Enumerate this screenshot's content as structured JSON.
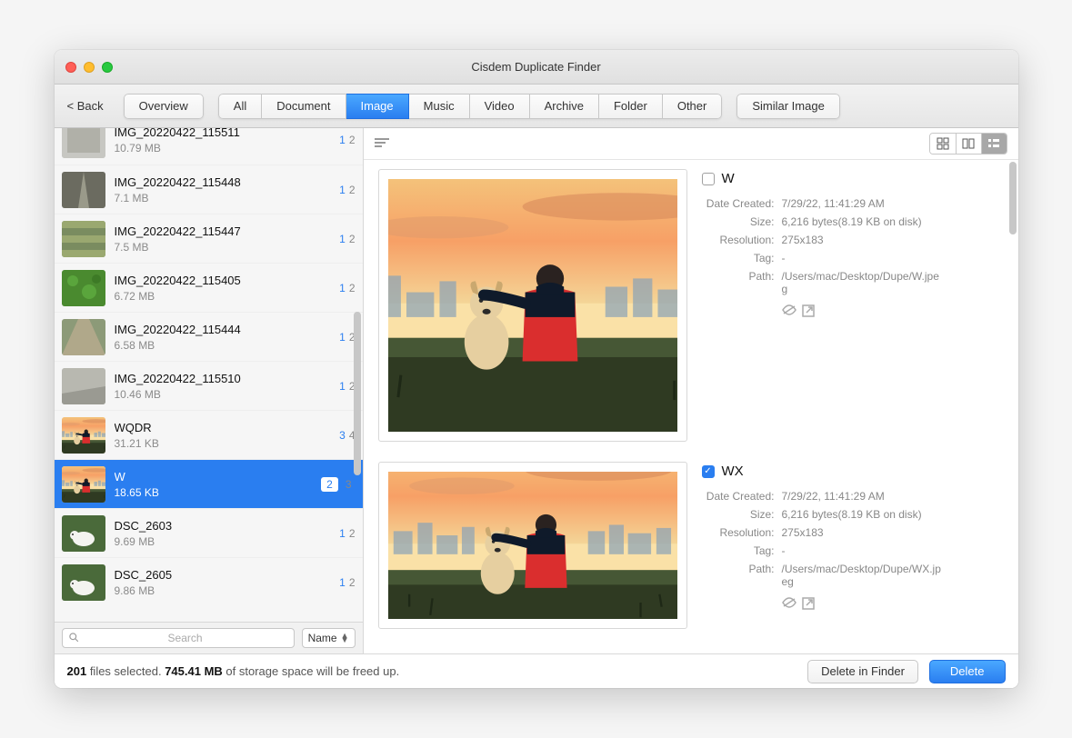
{
  "window": {
    "title": "Cisdem Duplicate Finder"
  },
  "toolbar": {
    "back": "< Back",
    "overview": "Overview",
    "tabs": [
      "All",
      "Document",
      "Image",
      "Music",
      "Video",
      "Archive",
      "Folder",
      "Other"
    ],
    "active_tab": "Image",
    "similar": "Similar Image"
  },
  "list": {
    "rows": [
      {
        "name": "IMG_20220422_115511",
        "size": "10.79 MB",
        "sel": "1",
        "tot": "2",
        "thumb": "concrete"
      },
      {
        "name": "IMG_20220422_115448",
        "size": "7.1 MB",
        "sel": "1",
        "tot": "2",
        "thumb": "road"
      },
      {
        "name": "IMG_20220422_115447",
        "size": "7.5 MB",
        "sel": "1",
        "tot": "2",
        "thumb": "bricks"
      },
      {
        "name": "IMG_20220422_115405",
        "size": "6.72 MB",
        "sel": "1",
        "tot": "2",
        "thumb": "leaves"
      },
      {
        "name": "IMG_20220422_115444",
        "size": "6.58 MB",
        "sel": "1",
        "tot": "2",
        "thumb": "path"
      },
      {
        "name": "IMG_20220422_115510",
        "size": "10.46 MB",
        "sel": "1",
        "tot": "2",
        "thumb": "stone"
      },
      {
        "name": "WQDR",
        "size": "31.21 KB",
        "sel": "3",
        "tot": "4",
        "thumb": "sunset"
      },
      {
        "name": "W",
        "size": "18.65 KB",
        "sel": "2",
        "tot": "3",
        "thumb": "sunset",
        "selected": true
      },
      {
        "name": "DSC_2603",
        "size": "9.69 MB",
        "sel": "1",
        "tot": "2",
        "thumb": "dog"
      },
      {
        "name": "DSC_2605",
        "size": "9.86 MB",
        "sel": "1",
        "tot": "2",
        "thumb": "dog"
      }
    ],
    "search_placeholder": "Search",
    "sort": "Name"
  },
  "detail": {
    "items": [
      {
        "checked": false,
        "name": "W",
        "date_created": "7/29/22, 11:41:29 AM",
        "size": "6,216 bytes(8.19 KB on disk)",
        "resolution": "275x183",
        "tag": "-",
        "path": "/Users/mac/Desktop/Dupe/W.jpeg"
      },
      {
        "checked": true,
        "name": "WX",
        "date_created": "7/29/22, 11:41:29 AM",
        "size": "6,216 bytes(8.19 KB on disk)",
        "resolution": "275x183",
        "tag": "-",
        "path": "/Users/mac/Desktop/Dupe/WX.jpeg"
      }
    ],
    "labels": {
      "date_created": "Date Created:",
      "size": "Size:",
      "resolution": "Resolution:",
      "tag": "Tag:",
      "path": "Path:"
    }
  },
  "footer": {
    "count": "201",
    "mid1": " files selected. ",
    "size": "745.41 MB",
    "mid2": " of storage space will be freed up.",
    "delete_finder": "Delete in Finder",
    "delete": "Delete"
  }
}
